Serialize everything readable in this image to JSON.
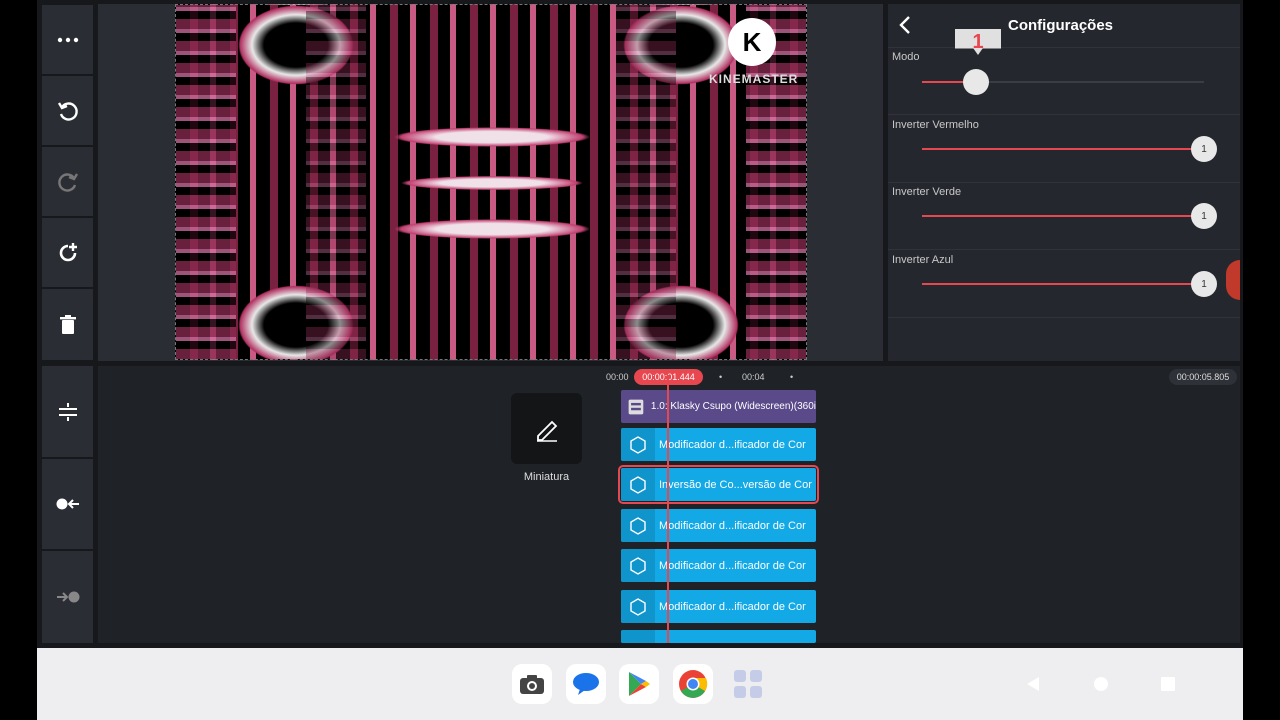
{
  "panel": {
    "title": "Configurações",
    "tooltip_value": "1",
    "modo_label": "Modo",
    "modo_fraction": 0.19,
    "sliders": [
      {
        "label": "Inverter Vermelho",
        "value": "1"
      },
      {
        "label": "Inverter Verde",
        "value": "1"
      },
      {
        "label": "Inverter Azul",
        "value": "1"
      }
    ]
  },
  "watermark": {
    "letter": "K",
    "text": "KINEMASTER"
  },
  "timeline": {
    "thumbnail_label": "Miniatura",
    "tc_start": "00:00",
    "tc_current": "00:00:01.444",
    "tc_mid": "00:04",
    "tc_end": "00:00:05.805",
    "main_clip": "1.0: Klasky Csupo (Widescreen)(360i",
    "fx_clips": [
      "Modificador d...ificador de Cor",
      "Inversão de Co...versão de Cor",
      "Modificador d...ificador de Cor",
      "Modificador d...ificador de Cor",
      "Modificador d...ificador de Cor"
    ]
  },
  "colors": {
    "accent": "#e8474f",
    "fx_clip": "#12a9e6",
    "main_clip": "#5a4a8a"
  },
  "toolbar_icons": [
    "more-icon",
    "undo-icon",
    "redo-icon",
    "add-rotate-icon",
    "delete-icon",
    "split-icon",
    "to-start-icon",
    "to-end-icon"
  ],
  "dock_apps": [
    "camera-icon",
    "messages-icon",
    "play-store-icon",
    "chrome-icon",
    "app-drawer-icon"
  ]
}
